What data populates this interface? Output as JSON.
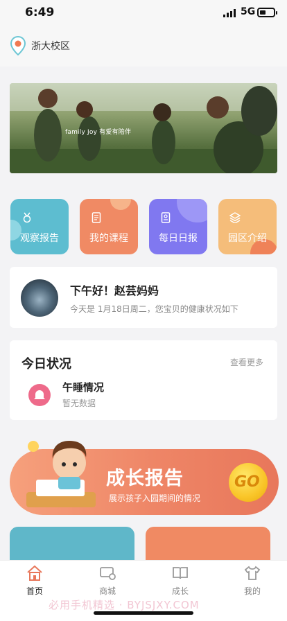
{
  "status": {
    "time": "6:49",
    "network": "5G"
  },
  "header": {
    "campus": "浙大校区"
  },
  "banner": {
    "caption": "family Joy 有爱有陪伴"
  },
  "tiles": [
    {
      "label": "观察报告",
      "color": "#5dbdd0"
    },
    {
      "label": "我的课程",
      "color": "#f08a64"
    },
    {
      "label": "每日日报",
      "color": "#8078f0"
    },
    {
      "label": "园区介绍",
      "color": "#f5bd7a"
    }
  ],
  "greeting": {
    "title": "下午好！赵芸妈妈",
    "subtitle": "今天是 1月18日周二，您宝贝的健康状况如下"
  },
  "today": {
    "title": "今日状况",
    "more": "查看更多",
    "nap_title": "午睡情况",
    "nap_status": "暂无数据"
  },
  "growth": {
    "title": "成长报告",
    "subtitle": "展示孩子入园期间的情况",
    "go": "GO"
  },
  "tabs": [
    {
      "label": "首页",
      "icon": "home-icon",
      "active": true
    },
    {
      "label": "商城",
      "icon": "shop-icon",
      "active": false
    },
    {
      "label": "成长",
      "icon": "book-icon",
      "active": false
    },
    {
      "label": "我的",
      "icon": "profile-icon",
      "active": false
    }
  ],
  "watermark": "必用手机精选 · BYJSJXY.COM",
  "colors": {
    "accent": "#e8775b",
    "tab_active": "#e8775b",
    "tab_inactive": "#888888"
  }
}
